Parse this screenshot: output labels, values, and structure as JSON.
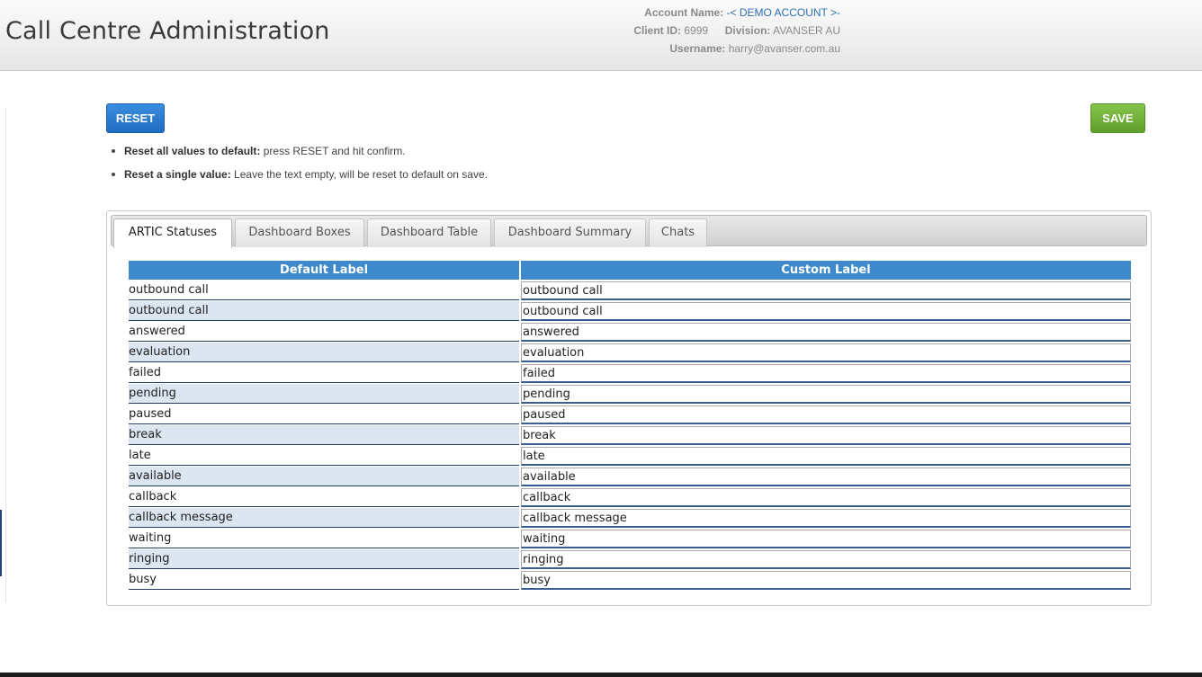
{
  "header": {
    "title": "Call Centre Administration",
    "account_name_label": "Account Name:",
    "account_name_value": "-< DEMO ACCOUNT >-",
    "client_id_label": "Client ID:",
    "client_id_value": "6999",
    "division_label": "Division:",
    "division_value": "AVANSER AU",
    "username_label": "Username:",
    "username_value": "harry@avanser.com.au"
  },
  "toolbar": {
    "reset_label": "RESET",
    "save_label": "SAVE"
  },
  "instructions": [
    {
      "bold": "Reset all values to default:",
      "text": " press RESET and hit confirm."
    },
    {
      "bold": "Reset a single value:",
      "text": " Leave the text empty, will be reset to default on save."
    }
  ],
  "tabs": [
    {
      "label": "ARTIC Statuses",
      "active": true
    },
    {
      "label": "Dashboard Boxes",
      "active": false
    },
    {
      "label": "Dashboard Table",
      "active": false
    },
    {
      "label": "Dashboard Summary",
      "active": false
    },
    {
      "label": "Chats",
      "active": false
    }
  ],
  "table": {
    "headers": [
      "Default Label",
      "Custom Label"
    ],
    "rows": [
      {
        "default": "outbound call",
        "custom": "outbound call"
      },
      {
        "default": "outbound call",
        "custom": "outbound call"
      },
      {
        "default": "answered",
        "custom": "answered"
      },
      {
        "default": "evaluation",
        "custom": "evaluation"
      },
      {
        "default": "failed",
        "custom": "failed"
      },
      {
        "default": "pending",
        "custom": "pending"
      },
      {
        "default": "paused",
        "custom": "paused"
      },
      {
        "default": "break",
        "custom": "break"
      },
      {
        "default": "late",
        "custom": "late"
      },
      {
        "default": "available",
        "custom": "available"
      },
      {
        "default": "callback",
        "custom": "callback"
      },
      {
        "default": "callback message",
        "custom": "callback message"
      },
      {
        "default": "waiting",
        "custom": "waiting"
      },
      {
        "default": "ringing",
        "custom": "ringing"
      },
      {
        "default": "busy",
        "custom": "busy"
      }
    ]
  },
  "colors": {
    "header_blue": "#3d89cb",
    "reset_blue": "#1f6bc0",
    "save_green": "#5e9e2a",
    "row_alt": "#dce6f1"
  }
}
